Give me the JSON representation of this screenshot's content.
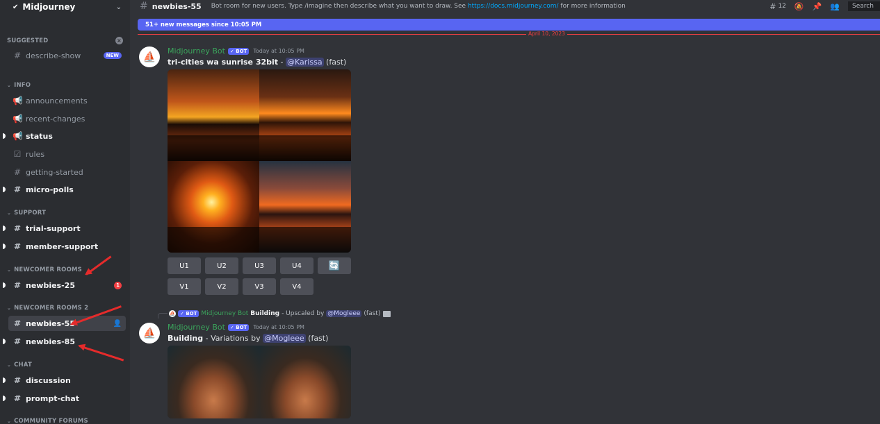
{
  "server": {
    "name": "Midjourney"
  },
  "sidebar": {
    "categories": {
      "suggested": "SUGGESTED",
      "info": "INFO",
      "support": "SUPPORT",
      "newcomer": "NEWCOMER ROOMS",
      "newcomer2": "NEWCOMER ROOMS 2",
      "chat": "CHAT",
      "forums": "COMMUNITY FORUMS"
    },
    "channels": {
      "describe_show": "describe-show",
      "new_badge": "NEW",
      "announcements": "announcements",
      "recent_changes": "recent-changes",
      "status": "status",
      "rules": "rules",
      "getting_started": "getting-started",
      "micro_polls": "micro-polls",
      "trial_support": "trial-support",
      "member_support": "member-support",
      "newbies_25": "newbies-25",
      "newbies_25_mentions": "1",
      "newbies_55": "newbies-55",
      "newbies_85": "newbies-85",
      "discussion": "discussion",
      "prompt_chat": "prompt-chat"
    },
    "annotation_color": "#e52b2b"
  },
  "channel": {
    "name": "newbies-55",
    "topic_prefix": "Bot room for new users. Type /imagine then describe what you want to draw. See ",
    "topic_link": "https://docs.midjourney.com/",
    "topic_suffix": " for more information",
    "thread_count": "12",
    "search_placeholder": "Search"
  },
  "new_messages_bar": "51+ new messages since 10:05 PM",
  "date_divider": "April 10, 2023",
  "messages": [
    {
      "author": "Midjourney Bot",
      "bot_tag": "BOT",
      "timestamp": "Today at 10:05 PM",
      "prompt": "tri-cities wa sunrise 32bit",
      "separator": " - ",
      "mention": "@Karissa",
      "mode": " (fast)",
      "buttons_upscale": [
        "U1",
        "U2",
        "U3",
        "U4"
      ],
      "buttons_variation": [
        "V1",
        "V2",
        "V3",
        "V4"
      ]
    },
    {
      "reply_bot_tag": "BOT",
      "reply_author": "Midjourney Bot",
      "reply_prompt": "Building",
      "reply_desc": "- Upscaled by",
      "reply_mention": "@Mogleee",
      "reply_mode": "(fast)",
      "author": "Midjourney Bot",
      "bot_tag": "BOT",
      "timestamp": "Today at 10:05 PM",
      "prompt": "Building",
      "desc": " - Variations by ",
      "mention": "@Mogleee",
      "mode": " (fast)"
    }
  ],
  "colors": {
    "blurple": "#5865f2",
    "bot_green": "#3ba55c",
    "link": "#00a8fc",
    "alert_red": "#f23f43"
  }
}
